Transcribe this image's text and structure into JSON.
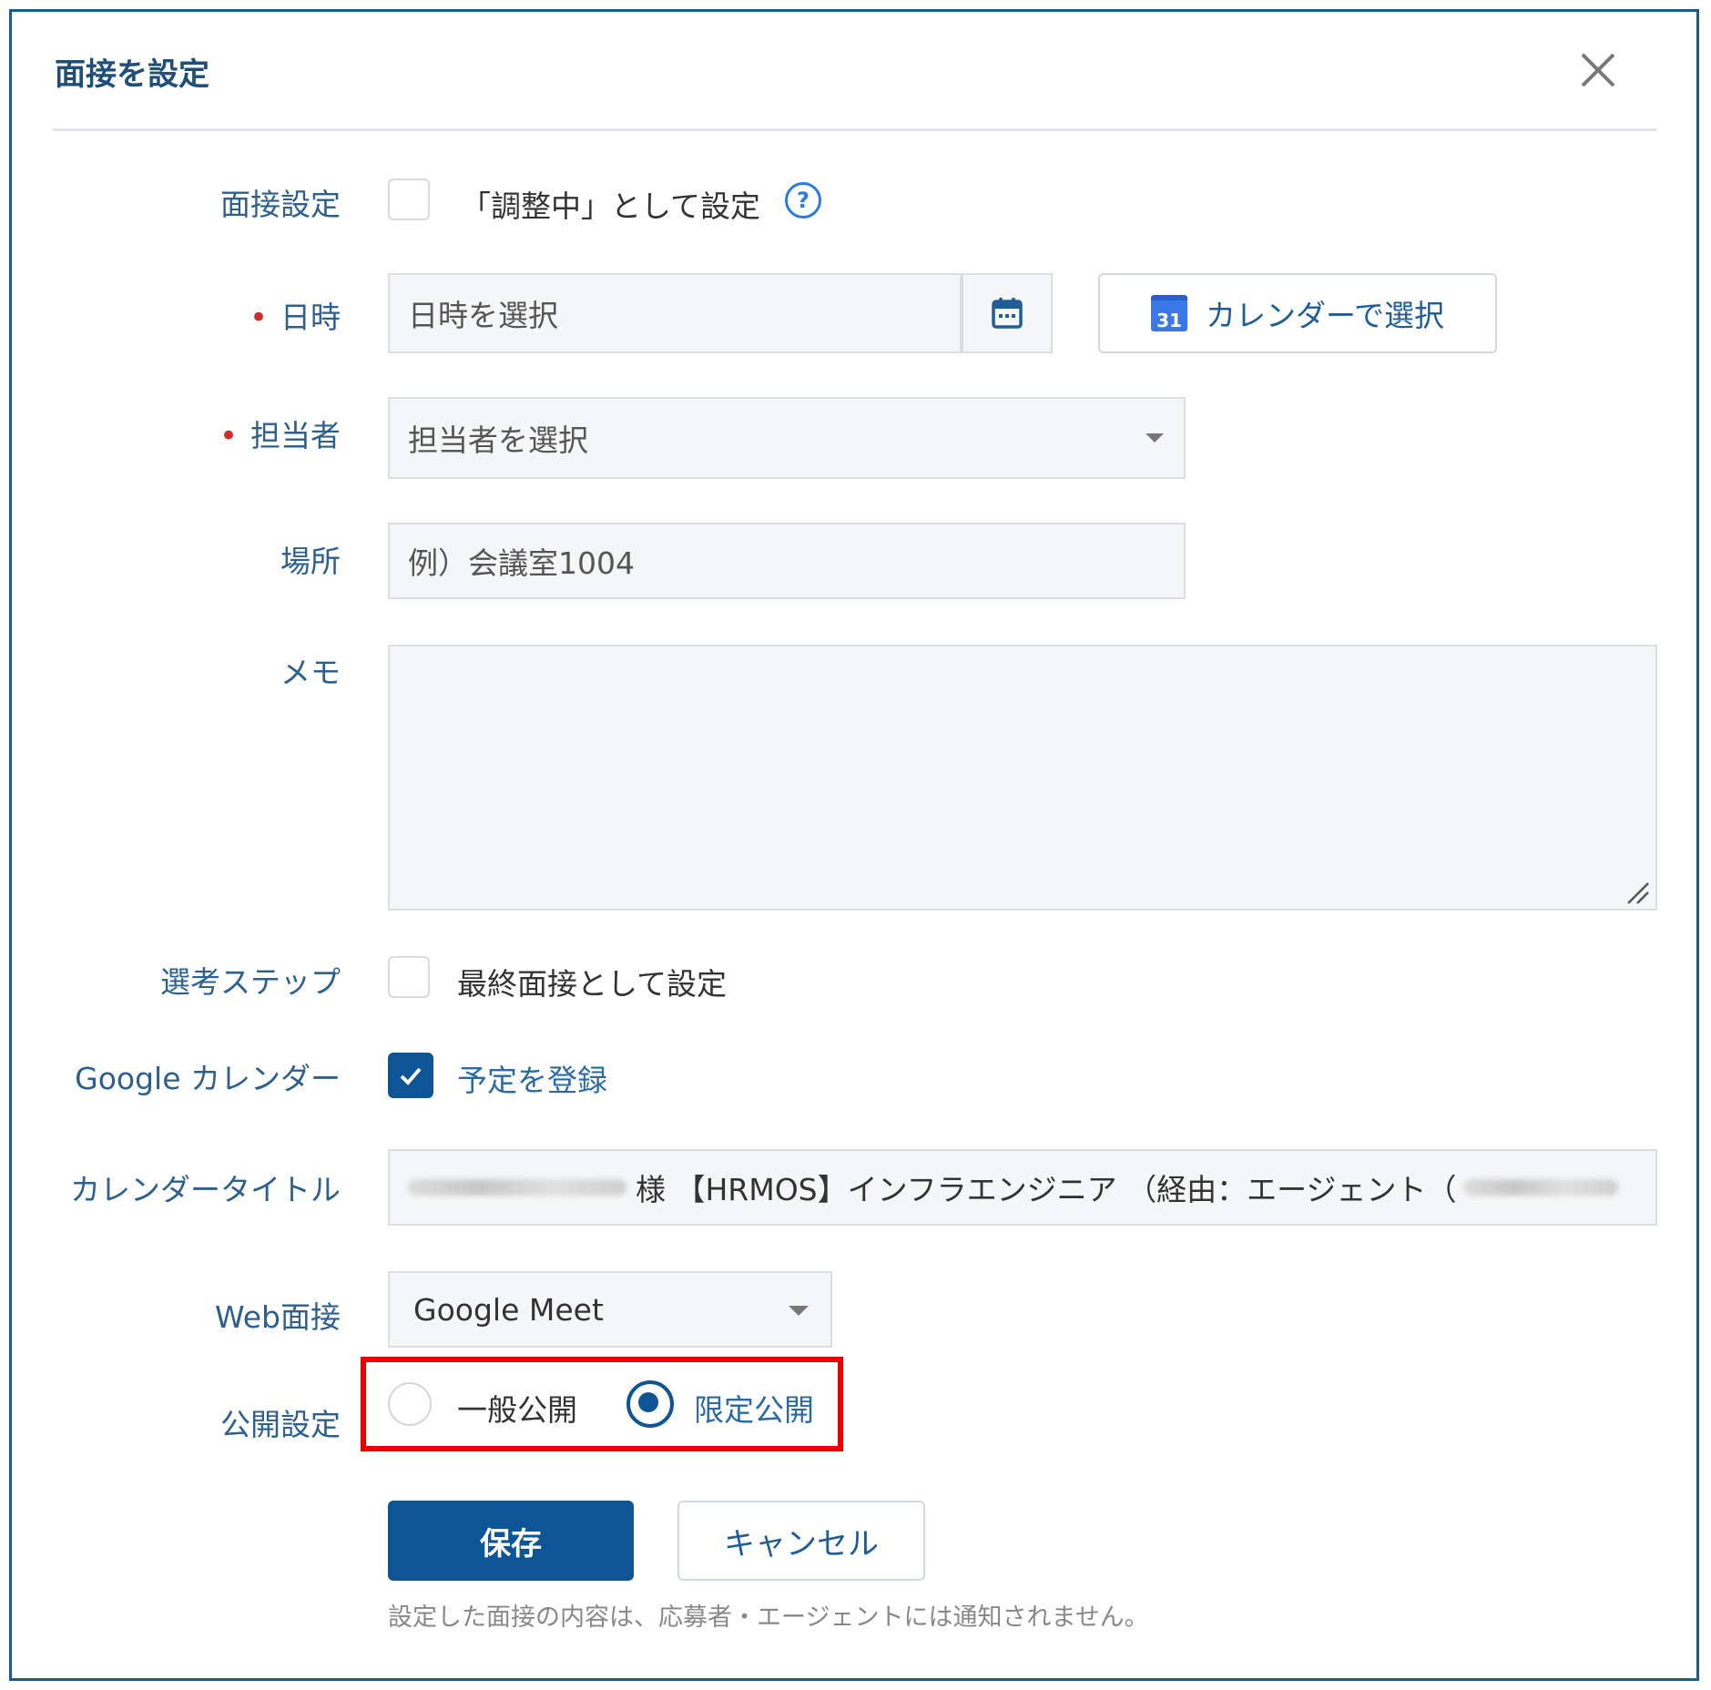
{
  "dialog": {
    "title": "面接を設定"
  },
  "form": {
    "interview_setting": {
      "label": "面接設定",
      "checkbox_label": "「調整中」として設定",
      "checked": false
    },
    "datetime": {
      "label": "日時",
      "placeholder": "日時を選択",
      "calendar_button_label": "カレンダーで選択",
      "calendar_badge": "31"
    },
    "assignee": {
      "label": "担当者",
      "placeholder": "担当者を選択"
    },
    "location": {
      "label": "場所",
      "placeholder": "例）会議室1004"
    },
    "memo": {
      "label": "メモ",
      "value": ""
    },
    "selection_step": {
      "label": "選考ステップ",
      "checkbox_label": "最終面接として設定",
      "checked": false
    },
    "google_calendar": {
      "label": "Google カレンダー",
      "checkbox_label": "予定を登録",
      "checked": true
    },
    "calendar_title": {
      "label": "カレンダータイトル",
      "value_visible": "様 【HRMOS】インフラエンジニア （経由：エージェント（"
    },
    "web_interview": {
      "label": "Web面接",
      "selected": "Google Meet"
    },
    "visibility": {
      "label": "公開設定",
      "options": [
        "一般公開",
        "限定公開"
      ],
      "selected": "限定公開"
    }
  },
  "actions": {
    "save_label": "保存",
    "cancel_label": "キャンセル"
  },
  "note": "設定した面接の内容は、応募者・エージェントには通知されません。",
  "colors": {
    "primary": "#0d5594",
    "label": "#2d5f8f",
    "required": "#d42a2a",
    "highlight": "#ee0000"
  }
}
